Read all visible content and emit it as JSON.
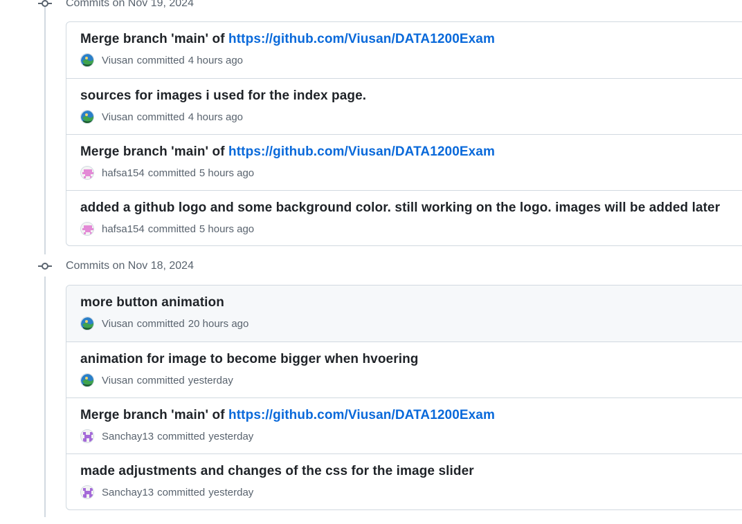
{
  "groups": [
    {
      "title": "Commits on Nov 19, 2024",
      "commits": [
        {
          "msg_prefix": "Merge branch 'main' of ",
          "msg_link": "https://github.com/Viusan/DATA1200Exam",
          "author": "Viusan",
          "verb": "committed",
          "time": "4 hours ago",
          "avatar": "earth-avatar"
        },
        {
          "msg_prefix": "sources for images i used for the index page.",
          "msg_link": "",
          "author": "Viusan",
          "verb": "committed",
          "time": "4 hours ago",
          "avatar": "earth-avatar"
        },
        {
          "msg_prefix": "Merge branch 'main' of ",
          "msg_link": "https://github.com/Viusan/DATA1200Exam",
          "author": "hafsa154",
          "verb": "committed",
          "time": "5 hours ago",
          "avatar": "pink-identicon"
        },
        {
          "msg_prefix": "added a github logo and some background color. still working on the logo. images will be added later",
          "msg_link": "",
          "author": "hafsa154",
          "verb": "committed",
          "time": "5 hours ago",
          "avatar": "pink-identicon"
        }
      ]
    },
    {
      "title": "Commits on Nov 18, 2024",
      "commits": [
        {
          "msg_prefix": "more button animation",
          "msg_link": "",
          "author": "Viusan",
          "verb": "committed",
          "time": "20 hours ago",
          "avatar": "earth-avatar"
        },
        {
          "msg_prefix": "animation for image to become bigger when hvoering",
          "msg_link": "",
          "author": "Viusan",
          "verb": "committed",
          "time": "yesterday",
          "avatar": "earth-avatar"
        },
        {
          "msg_prefix": "Merge branch 'main' of ",
          "msg_link": "https://github.com/Viusan/DATA1200Exam",
          "author": "Sanchay13",
          "verb": "committed",
          "time": "yesterday",
          "avatar": "purple-identicon"
        },
        {
          "msg_prefix": "made adjustments and changes of the css for the image slider",
          "msg_link": "",
          "author": "Sanchay13",
          "verb": "committed",
          "time": "yesterday",
          "avatar": "purple-identicon"
        }
      ]
    }
  ],
  "colors": {
    "link": "#0969da",
    "muted": "#59636e",
    "border": "#d1d9e0",
    "hover_bg": "#f6f8fa"
  }
}
